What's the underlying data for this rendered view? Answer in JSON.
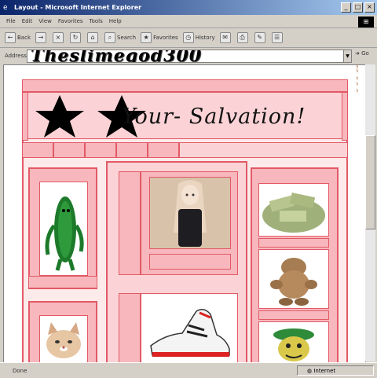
{
  "window": {
    "title": "Layout - Microsoft Internet Explorer",
    "buttons": [
      "_",
      "□",
      "×"
    ]
  },
  "menu": {
    "items": [
      "File",
      "Edit",
      "View",
      "Favorites",
      "Tools",
      "Help"
    ]
  },
  "toolbar": {
    "back": "Back",
    "search": "Search",
    "favorites": "Favorites",
    "history": "History"
  },
  "address": {
    "label": "Address",
    "value": "Theslimegod300",
    "go": "Go"
  },
  "page": {
    "heading": "Your- Salvation!"
  },
  "status": {
    "text": "Done",
    "zone": "Internet"
  },
  "colors": {
    "accent": "#e25965",
    "pink": "#f7b7bd",
    "pale": "#fddde0"
  }
}
